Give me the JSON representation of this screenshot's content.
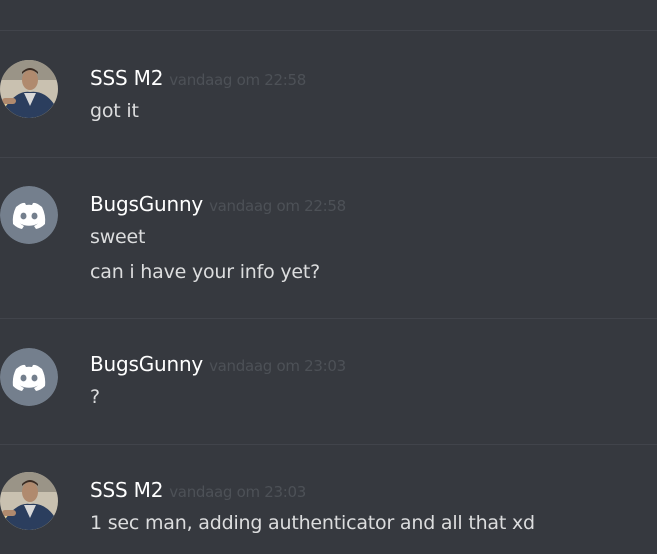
{
  "messages": [
    {
      "author": "SSS M2",
      "timestamp": "vandaag om 22:58",
      "avatar_icon": "user-photo-avatar",
      "lines": [
        "got it"
      ]
    },
    {
      "author": "BugsGunny",
      "timestamp": "vandaag om 22:58",
      "avatar_icon": "discord-default-avatar",
      "lines": [
        "sweet",
        "can i have your info yet?"
      ]
    },
    {
      "author": "BugsGunny",
      "timestamp": "vandaag om 23:03",
      "avatar_icon": "discord-default-avatar",
      "lines": [
        "?"
      ]
    },
    {
      "author": "SSS M2",
      "timestamp": "vandaag om 23:03",
      "avatar_icon": "user-photo-avatar",
      "lines": [
        "1 sec man, adding authenticator and all that xd"
      ]
    }
  ],
  "colors": {
    "background": "#36393f",
    "divider": "#41444b",
    "username": "#ffffff",
    "timestamp": "#4d5157",
    "message_text": "#dcddde",
    "default_avatar": "#747f8d"
  }
}
